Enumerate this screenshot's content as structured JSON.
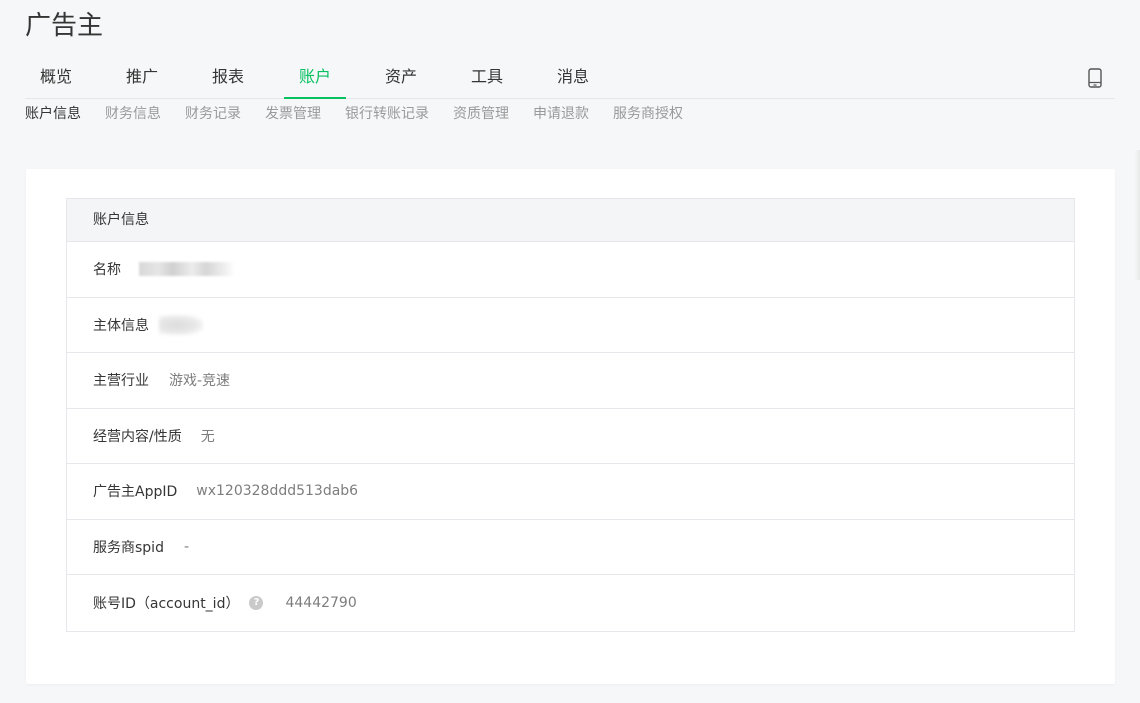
{
  "page_title": "广告主",
  "main_nav": {
    "tabs": [
      {
        "label": "概览",
        "active": false
      },
      {
        "label": "推广",
        "active": false
      },
      {
        "label": "报表",
        "active": false
      },
      {
        "label": "账户",
        "active": true
      },
      {
        "label": "资产",
        "active": false
      },
      {
        "label": "工具",
        "active": false
      },
      {
        "label": "消息",
        "active": false
      }
    ],
    "accent_color": "#07c160",
    "right_icon": "mobile-phone-icon"
  },
  "sub_nav": {
    "items": [
      {
        "label": "账户信息",
        "active": true
      },
      {
        "label": "财务信息",
        "active": false
      },
      {
        "label": "财务记录",
        "active": false
      },
      {
        "label": "发票管理",
        "active": false
      },
      {
        "label": "银行转账记录",
        "active": false
      },
      {
        "label": "资质管理",
        "active": false
      },
      {
        "label": "申请退款",
        "active": false
      },
      {
        "label": "服务商授权",
        "active": false
      }
    ]
  },
  "account_info": {
    "header": "账户信息",
    "rows": [
      {
        "label": "名称",
        "value": "",
        "redacted": true
      },
      {
        "label": "主体信息",
        "value": "",
        "redacted": true
      },
      {
        "label": "主营行业",
        "value": "游戏-竞速"
      },
      {
        "label": "经营内容/性质",
        "value": "无"
      },
      {
        "label": "广告主AppID",
        "value": "wx120328ddd513dab6"
      },
      {
        "label": "服务商spid",
        "value": "-"
      },
      {
        "label": "账号ID（account_id）",
        "value": "44442790",
        "help_icon": "question-mark-icon"
      }
    ]
  }
}
